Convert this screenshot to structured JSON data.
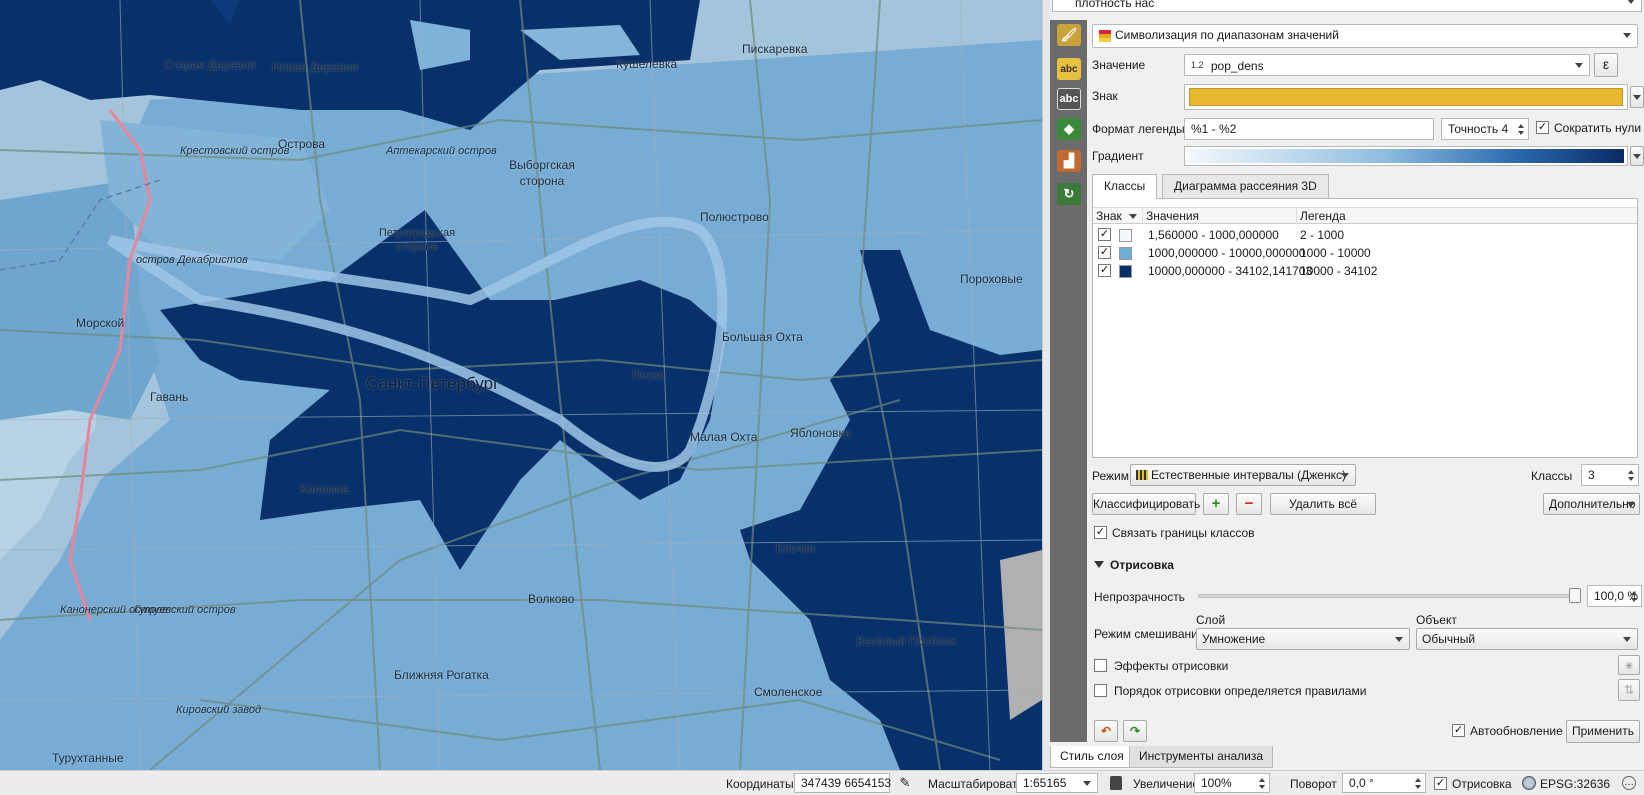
{
  "layer_combo": {
    "value": "плотность нас"
  },
  "renderer": {
    "value": "Символизация по диапазонам значений"
  },
  "value_row": {
    "label": "Значение",
    "prefix": "1.2",
    "field": "pop_dens",
    "expression_button": "ε"
  },
  "symbol_row": {
    "label": "Знак",
    "color": "#e8b830"
  },
  "legend_format_row": {
    "label": "Формат легенды",
    "value": "%1 - %2",
    "precision": "Точность 4",
    "trim_label": "Сократить нули",
    "trim_checked": "✓"
  },
  "gradient_row": {
    "label": "Градиент"
  },
  "tabs": [
    {
      "label": "Классы"
    },
    {
      "label": "Диаграмма рассеяния 3D"
    }
  ],
  "class_table": {
    "headers": [
      "Знак",
      "Значения",
      "Легенда"
    ],
    "rows": [
      {
        "checked": "✓",
        "color": "#f5f9fd",
        "values": "1,560000 - 1000,000000",
        "legend": "2 - 1000"
      },
      {
        "checked": "✓",
        "color": "#6baed6",
        "values": "1000,000000 - 10000,000000",
        "legend": "1000 - 10000"
      },
      {
        "checked": "✓",
        "color": "#08306b",
        "values": "10000,000000 - 34102,141703",
        "legend": "10000 - 34102"
      }
    ]
  },
  "mode": {
    "label": "Режим",
    "value": "Естественные интервалы (Дженкс)"
  },
  "classes": {
    "label": "Классы",
    "value": "3"
  },
  "buttons": {
    "classify": "Классифицировать",
    "add": "+",
    "remove": "−",
    "delete_all": "Удалить всё",
    "advanced": "Дополнительно"
  },
  "link_boundaries": {
    "label": "Связать границы классов",
    "checked": "✓"
  },
  "rendering": {
    "header": "Отрисовка",
    "opacity_label": "Непрозрачность",
    "opacity_value": "100,0 %",
    "opacity_fraction": 1.0,
    "blend_label": "Режим смешивания",
    "layer_label": "Слой",
    "layer_value": "Умножение",
    "object_label": "Объект",
    "object_value": "Обычный",
    "effects_label": "Эффекты отрисовки",
    "order_label": "Порядок отрисовки определяется правилами"
  },
  "footer": {
    "auto_update_label": "Автообновление",
    "auto_checked": "✓",
    "apply": "Применить"
  },
  "bottom_tabs": [
    {
      "label": "Стиль слоя"
    },
    {
      "label": "Инструменты анализа"
    }
  ],
  "statusbar": {
    "coords_label": "Координаты",
    "coords_value": "347439 6654153",
    "scale_label": "Масштабировать",
    "scale_value": "1:65165",
    "zoom_label": "Увеличение",
    "zoom_value": "100%",
    "rotation_label": "Поворот",
    "rotation_value": "0,0 °",
    "render_label": "Отрисовка",
    "render_checked": "✓",
    "crs": "EPSG:32636"
  },
  "map_labels": {
    "staraya_derevnya": "Старая Деревня",
    "novaya_derevnya": "Новая Деревня",
    "piskarevka": "Пискаревка",
    "kushelevka": "Кушелевка",
    "ostrova": "Острова",
    "krestovsky": "Крестовский остров",
    "aptekarsky": "Аптекарский остров",
    "vyborgskaya": "Выборгская сторона",
    "petrogradskaya": "Петроградская сторона",
    "polyustrovo": "Полюстрово",
    "porokhovye": "Пороховые",
    "dekabristov": "остров Декабристов",
    "morskoy": "Морской",
    "bolshaya_okhta": "Большая Охта",
    "spb": "Санкт-Петербург",
    "peski": "Пески",
    "gavan": "Гавань",
    "kolomna": "Коломна",
    "malaya_okhta": "Малая Охта",
    "yablonovka": "Яблоновка",
    "klochki": "Клочки",
    "volkovo": "Волково",
    "vesely": "Весёлый Посёлок",
    "blizhnyaya": "Ближняя Рогатка",
    "smolenskoe": "Смоленское",
    "kanonersky": "Канонерский остров",
    "gutuevsky": "Гутуевский остров",
    "kirovsky": "Кировский завод",
    "turukhtannye": "Турухтанные"
  }
}
